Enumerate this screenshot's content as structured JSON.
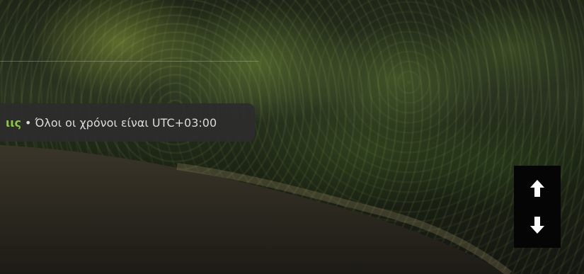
{
  "footer": {
    "link_fragment": "ιις",
    "bullet": "•",
    "timezone_text": "Όλοι οι χρόνοι είναι UTC+03:00"
  },
  "scroll_controls": {
    "up_icon": "arrow-up-icon",
    "down_icon": "arrow-down-icon"
  },
  "colors": {
    "link": "#88c93f",
    "bar_background": "#2c2c2c",
    "scroll_box": "#050505"
  }
}
